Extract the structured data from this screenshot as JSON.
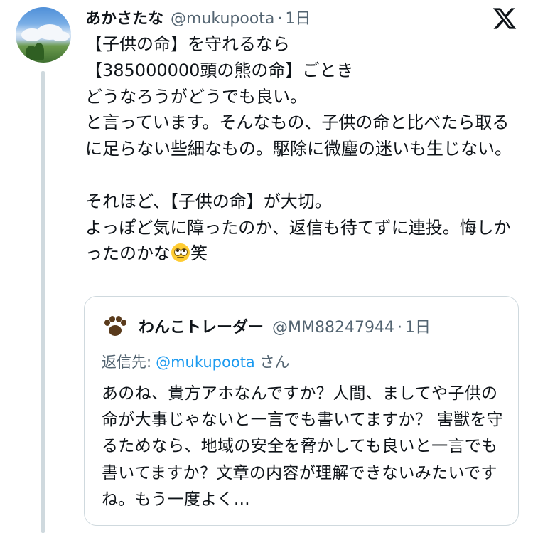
{
  "tweet": {
    "display_name": "あかさたな",
    "handle": "@mukupoota",
    "separator": "·",
    "time": "1日",
    "text_part1": "【子供の命】を守れるなら\n【385000000頭の熊の命】ごとき\nどうなろうがどうでも良い。\nと言っています。そんなもの、子供の命と比べたら取るに足らない些細なもの。駆除に微塵の迷いも生じない。\n\nそれほど、【子供の命】が大切。\nよっぽど気に障ったのか、返信も待てずに連投。悔しかったのかな",
    "emoji": "face-with-rolling-eyes",
    "text_part2": "笑"
  },
  "quoted_tweet": {
    "display_name": "わんこトレーダー",
    "handle": "@MM88247944",
    "separator": "·",
    "time": "1日",
    "replying_label": "返信先:",
    "replying_mention": "@mukupoota",
    "replying_suffix": "さん",
    "text": "あのね、貴方アホなんですか？人間、ましてや子供の命が大事じゃないと一言でも書いてますか？ 害獣を守るためなら、地域の安全を脅かしても良いと一言でも書いてますか？文章の内容が理解できないみたいですね。もう一度よく…"
  },
  "icons": {
    "logo": "x-logo-icon",
    "quoted_avatar": "paw-icon"
  },
  "colors": {
    "text": "#0f1419",
    "secondary": "#536471",
    "link": "#1d9bf0",
    "border": "#cfd9de"
  }
}
